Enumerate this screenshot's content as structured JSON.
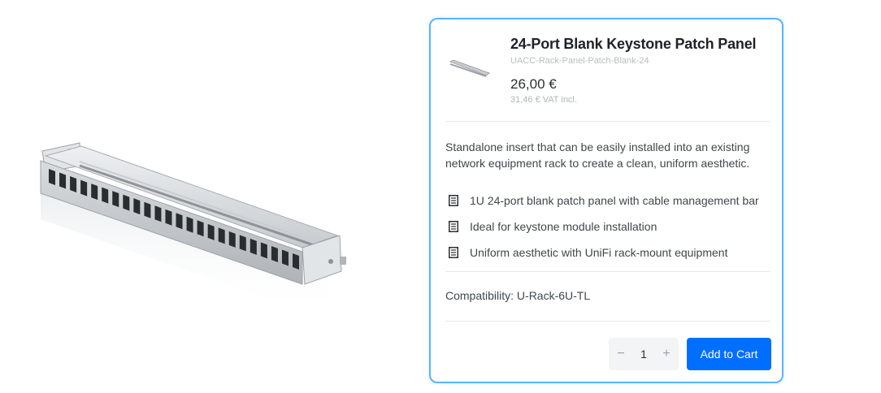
{
  "product": {
    "title": "24-Port Blank Keystone Patch Panel",
    "sku": "UACC-Rack-Panel-Patch-Blank-24",
    "price": "26,00 €",
    "vat_price": "31,46 € VAT incl.",
    "description": "Standalone insert that can be easily installed into an existing network equipment rack to create a clean, uniform aesthetic.",
    "features": [
      {
        "icon": "spec-sheet-icon",
        "label": "1U 24-port blank patch panel with cable management bar"
      },
      {
        "icon": "spec-sheet-icon",
        "label": "Ideal for keystone module installation"
      },
      {
        "icon": "spec-sheet-icon",
        "label": "Uniform aesthetic with UniFi rack-mount equipment"
      }
    ],
    "compatibility": "Compatibility: U-Rack-6U-TL"
  },
  "cart": {
    "quantity": "1",
    "decrement": "−",
    "increment": "+",
    "add_label": "Add to Cart"
  },
  "colors": {
    "accent": "#006fff",
    "card_border": "#59b4ff"
  }
}
